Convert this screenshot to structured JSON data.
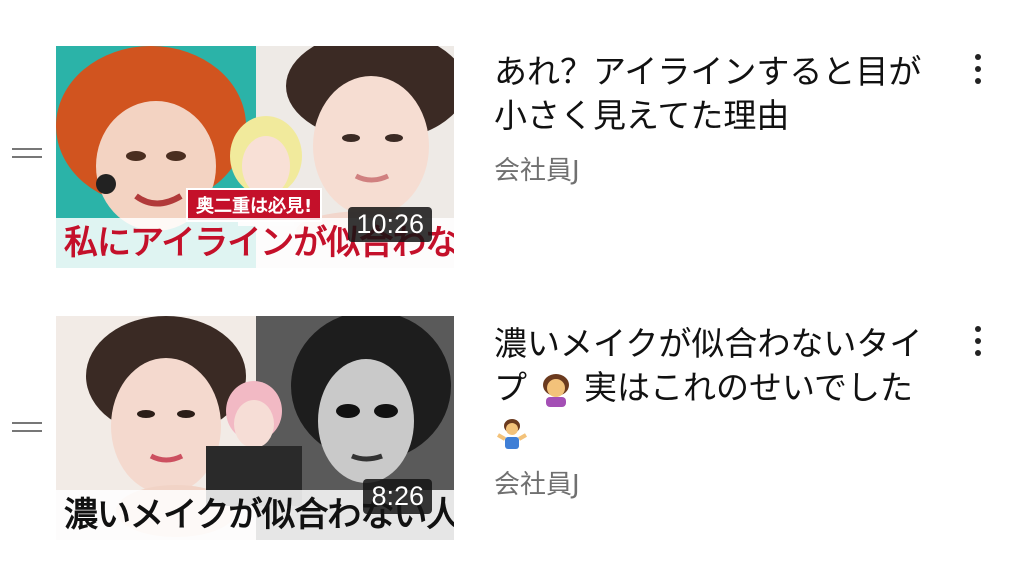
{
  "videos": [
    {
      "title": "あれ？アイラインすると目が小さく見えてた理由",
      "channel": "会社員J",
      "duration": "10:26",
      "thumbnail_caption": "私にアイラインが似合わない理由",
      "thumbnail_badge": "奥二重は必見!"
    },
    {
      "title_part1": "濃いメイクが似合わないタイプ",
      "title_part2": "実はこれのせいでした",
      "channel": "会社員J",
      "duration": "8:26",
      "thumbnail_caption": "濃いメイクが似合わない人"
    }
  ],
  "icons": {
    "drag_handle": "drag-handle-icon",
    "more": "more-vert-icon",
    "emoji_facepalm": "woman-facepalming-emoji",
    "emoji_shrug": "man-shrugging-emoji"
  },
  "colors": {
    "caption_red": "#c4102a",
    "channel_gray": "#707070"
  }
}
